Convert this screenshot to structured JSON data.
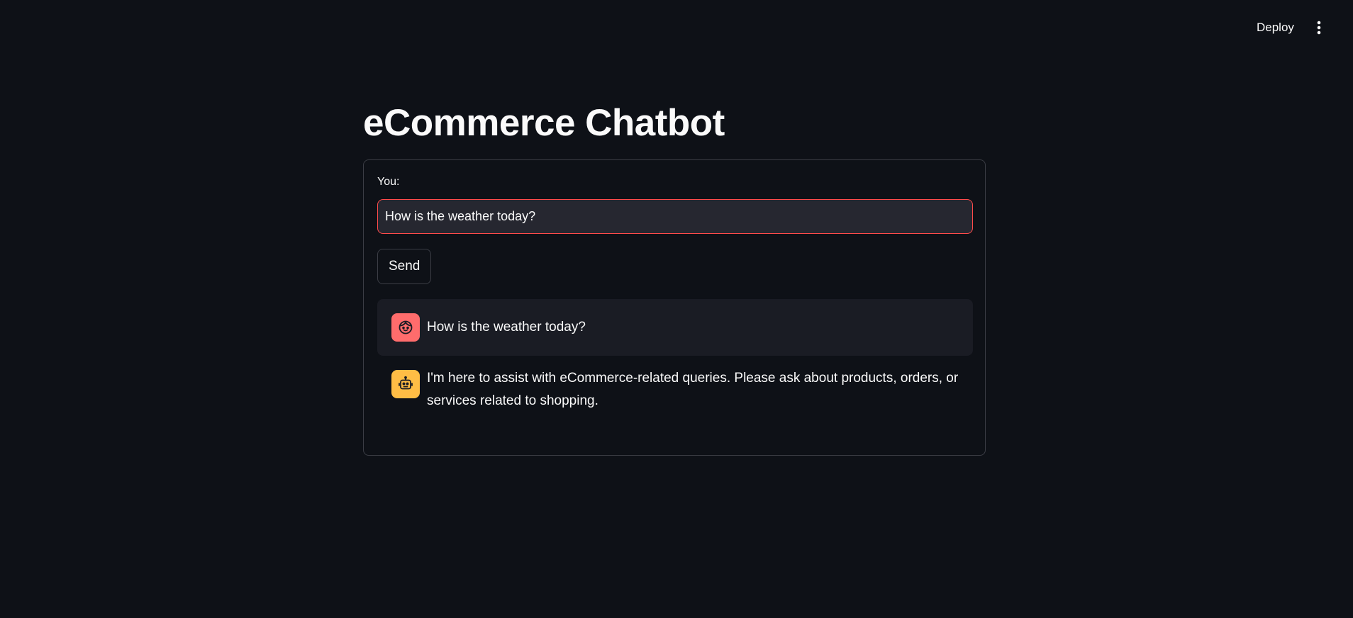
{
  "header": {
    "deploy_label": "Deploy",
    "menu_icon": "vertical-dots-icon"
  },
  "main": {
    "title": "eCommerce Chatbot",
    "form": {
      "input_label": "You:",
      "input_value": "How is the weather today?",
      "send_label": "Send"
    },
    "messages": [
      {
        "role": "user",
        "avatar_icon": "user-face-icon",
        "text": "How is the weather today?"
      },
      {
        "role": "assistant",
        "avatar_icon": "robot-icon",
        "text": "I'm here to assist with eCommerce-related queries. Please ask about products, orders, or services related to shopping."
      }
    ]
  },
  "colors": {
    "background": "#0e1117",
    "accent": "#ff4b4b",
    "user_avatar": "#ff6c6c",
    "bot_avatar": "#ffbd45",
    "message_bg": "#1a1c24"
  }
}
